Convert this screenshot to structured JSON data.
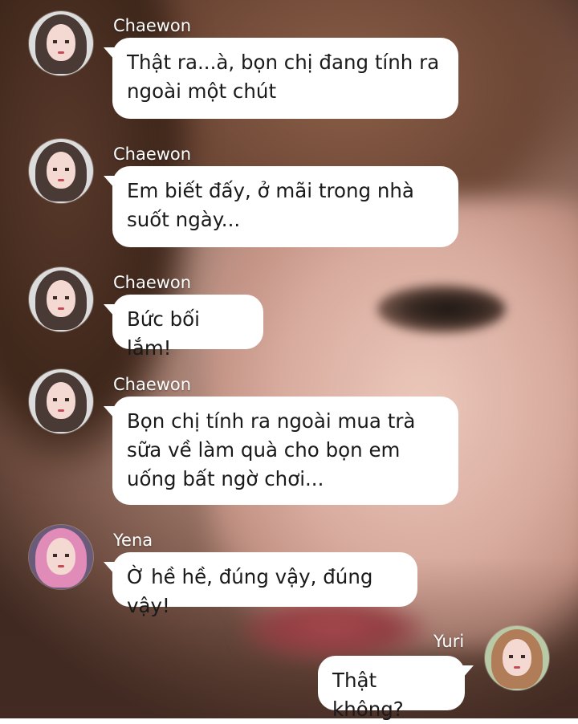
{
  "background": {
    "description_icon": "blurred-face-photo"
  },
  "messages": [
    {
      "sender": "Chaewon",
      "side": "left",
      "text": "Thật ra...à, bọn chị đang tính ra\nngoài một chút"
    },
    {
      "sender": "Chaewon",
      "side": "left",
      "text": "Em biết đấy, ở mãi trong nhà\nsuốt ngày..."
    },
    {
      "sender": "Chaewon",
      "side": "left",
      "text": "Bức bối lắm!"
    },
    {
      "sender": "Chaewon",
      "side": "left",
      "text": "Bọn chị tính ra ngoài mua trà\nsữa về làm quà cho bọn em\nuống bất ngờ chơi..."
    },
    {
      "sender": "Yena",
      "side": "left",
      "text": "Ờ hề hề, đúng vậy, đúng vậy!"
    },
    {
      "sender": "Yuri",
      "side": "right",
      "text": "Thật không?"
    }
  ],
  "colors": {
    "bubble": "#ffffff",
    "bubble_text": "#1a1a1a",
    "name_text": "#ffffff"
  }
}
